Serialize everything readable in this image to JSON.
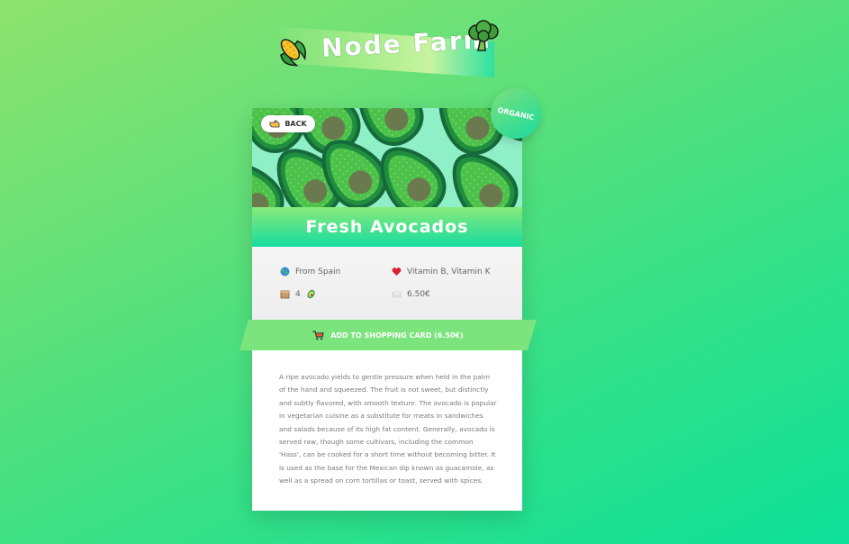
{
  "header": {
    "title": "Node Farm",
    "left_icon": "corn-icon",
    "right_icon": "broccoli-icon"
  },
  "product": {
    "back_label": "BACK",
    "badge_label": "ORGANIC",
    "name": "Fresh Avocados",
    "origin": "From Spain",
    "nutrients": "Vitamin B, Vitamin K",
    "quantity": "4",
    "price": "6.50€",
    "cart_label": "ADD TO SHOPPING CARD (6.50€)",
    "description": "A ripe avocado yields to gentle pressure when held in the palm of the hand and squeezed. The fruit is not sweet, but distinctly and subtly flavored, with smooth texture. The avocado is popular in vegetarian cuisine as a substitute for meats in sandwiches and salads because of its high fat content. Generally, avocado is served raw, though some cultivars, including the common 'Hass', can be cooked for a short time without becoming bitter. It is used as the base for the Mexican dip known as guacamole, as well as a spread on corn tortillas or toast, served with spices."
  },
  "icons": {
    "back": "pointing-hand-icon",
    "origin": "globe-icon",
    "nutrients": "heart-icon",
    "quantity": "box-icon",
    "quantity_item": "avocado-icon",
    "price": "money-icon",
    "cart": "cart-icon"
  },
  "colors": {
    "accent": "#7be47c",
    "accent_dark": "#16dca0"
  }
}
